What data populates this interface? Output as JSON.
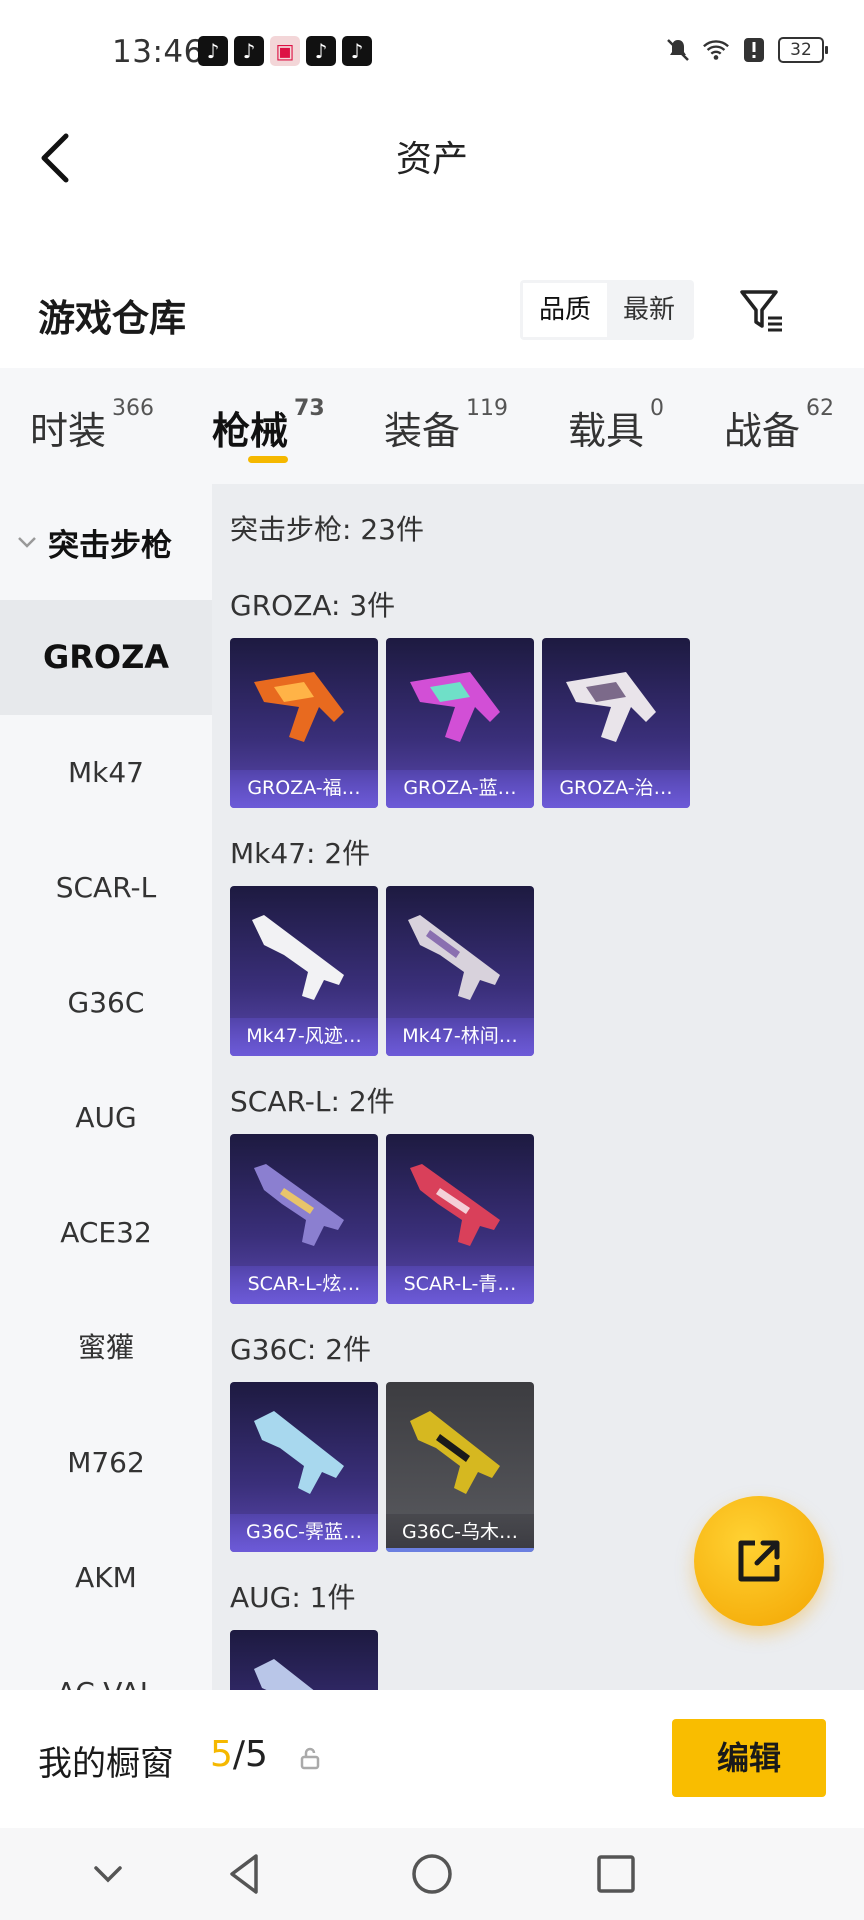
{
  "status_bar": {
    "time": "13:46",
    "battery": "32",
    "app_icons": [
      "tiktok-icon",
      "tiktok-icon",
      "gift-box-icon",
      "tiktok-icon",
      "tiktok-icon"
    ],
    "system_icons": [
      "mute-icon",
      "wifi-icon",
      "alert-icon",
      "battery-icon"
    ]
  },
  "header": {
    "title": "资产"
  },
  "warehouse": {
    "title": "游戏仓库",
    "sort_options": [
      "品质",
      "最新"
    ],
    "sort_selected": "品质"
  },
  "tabs": [
    {
      "label": "时装",
      "count": "366"
    },
    {
      "label": "枪械",
      "count": "73",
      "active": true
    },
    {
      "label": "装备",
      "count": "119"
    },
    {
      "label": "载具",
      "count": "0"
    },
    {
      "label": "战备",
      "count": "62"
    }
  ],
  "sidebar": {
    "header": "突击步枪",
    "items": [
      "GROZA",
      "Mk47",
      "SCAR-L",
      "G36C",
      "AUG",
      "ACE32",
      "蜜獾",
      "M762",
      "AKM",
      "AC-VAL"
    ],
    "active": "GROZA"
  },
  "content": {
    "heading": "突击步枪: 23件",
    "groups": [
      {
        "title": "GROZA: 3件",
        "items": [
          "GROZA-福…",
          "GROZA-蓝…",
          "GROZA-治…"
        ]
      },
      {
        "title": "Mk47: 2件",
        "items": [
          "Mk47-风迹…",
          "Mk47-林间…"
        ]
      },
      {
        "title": "SCAR-L: 2件",
        "items": [
          "SCAR-L-炫…",
          "SCAR-L-青…"
        ]
      },
      {
        "title": "G36C: 2件",
        "items": [
          "G36C-霁蓝…",
          "G36C-乌木…"
        ]
      },
      {
        "title": "AUG: 1件",
        "items": [
          ""
        ]
      }
    ]
  },
  "bottom": {
    "label": "我的橱窗",
    "count_current": "5",
    "count_sep": "/",
    "count_total": "5",
    "edit_button": "编辑"
  },
  "colors": {
    "accent": "#f9bd00",
    "card_purple": "#3a2f7a",
    "card_gray": "#5a5b60"
  }
}
